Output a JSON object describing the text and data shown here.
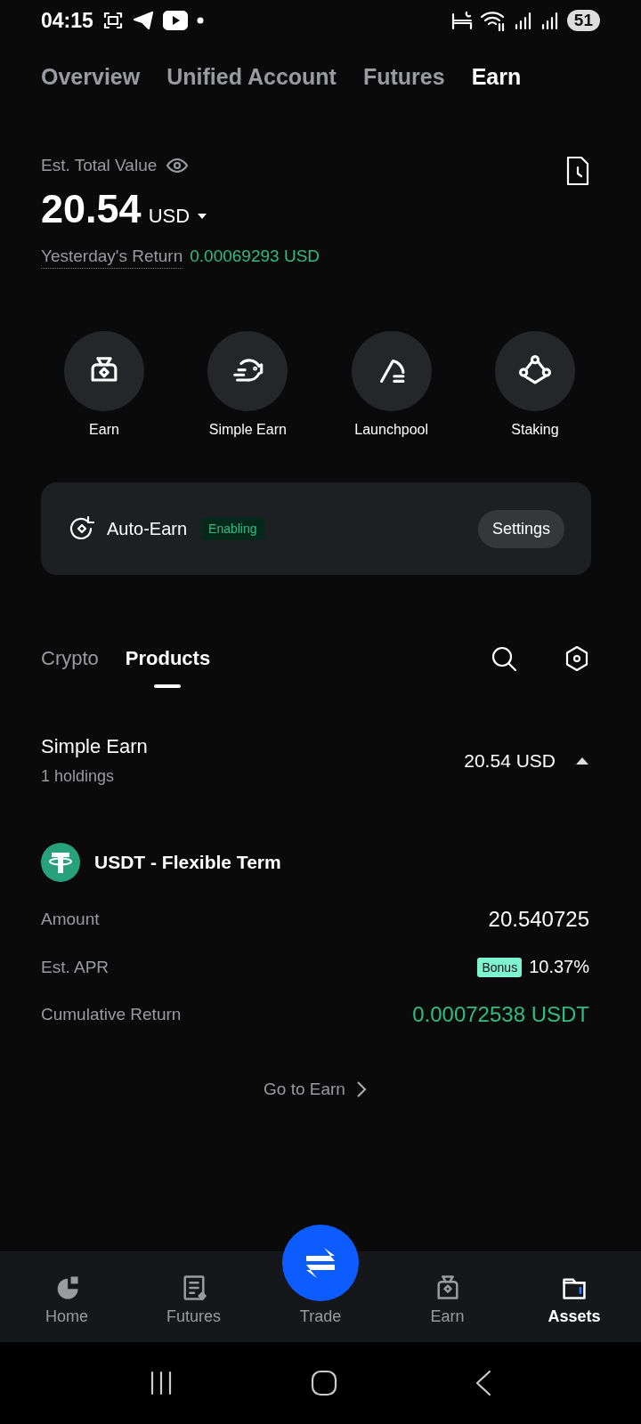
{
  "status_bar": {
    "time": "04:15",
    "battery": "51"
  },
  "tabs": [
    {
      "label": "Overview",
      "selected": false
    },
    {
      "label": "Unified Account",
      "selected": false
    },
    {
      "label": "Futures",
      "selected": false
    },
    {
      "label": "Earn",
      "selected": true
    }
  ],
  "balance": {
    "label": "Est. Total Value",
    "amount": "20.54",
    "currency": "USD",
    "yesterday_label": "Yesterday's Return",
    "yesterday_value": "0.00069293 USD"
  },
  "shortcuts": [
    {
      "label": "Earn"
    },
    {
      "label": "Simple Earn"
    },
    {
      "label": "Launchpool"
    },
    {
      "label": "Staking"
    }
  ],
  "auto_earn": {
    "title": "Auto-Earn",
    "status": "Enabling",
    "button": "Settings"
  },
  "section_tabs": [
    {
      "label": "Crypto",
      "selected": false
    },
    {
      "label": "Products",
      "selected": true
    }
  ],
  "group": {
    "title": "Simple Earn",
    "subtitle": "1 holdings",
    "total": "20.54 USD",
    "expanded": true
  },
  "product": {
    "name": "USDT - Flexible Term",
    "rows": [
      {
        "label": "Amount",
        "value": "20.540725",
        "positive": false
      },
      {
        "label": "Est. APR",
        "badge": "Bonus",
        "value": "10.37%",
        "positive": false
      },
      {
        "label": "Cumulative Return",
        "value": "0.00072538 USDT",
        "positive": true
      }
    ]
  },
  "link": "Go to Earn",
  "bottom_nav": [
    {
      "label": "Home",
      "selected": false
    },
    {
      "label": "Futures",
      "selected": false
    },
    {
      "label": "Trade",
      "selected": false,
      "kind": "fab"
    },
    {
      "label": "Earn",
      "selected": false
    },
    {
      "label": "Assets",
      "selected": true
    }
  ]
}
